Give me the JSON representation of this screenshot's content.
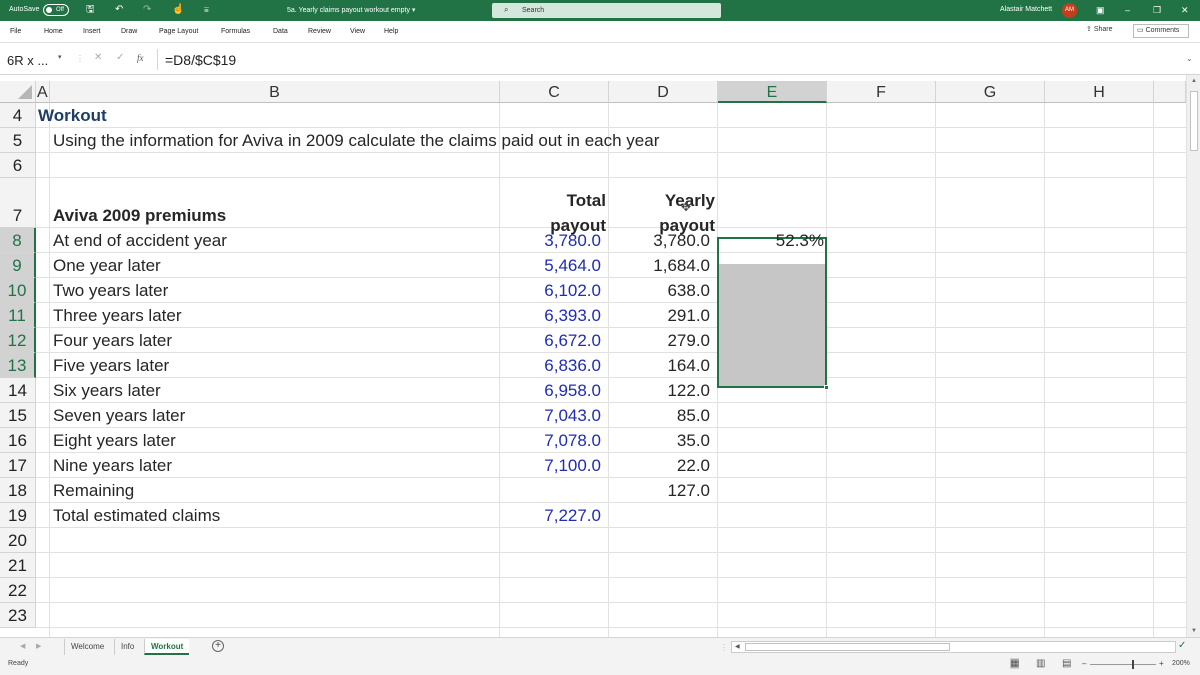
{
  "titlebar": {
    "autosave_label": "AutoSave",
    "autosave_state": "Off",
    "doc_title": "5a. Yearly claims payout workout empty",
    "doc_title_arrow": "▾",
    "search_placeholder": "Search",
    "user_name": "Alastair Matchett",
    "user_initials": "AM",
    "bg_color": "#217346"
  },
  "ribbon": {
    "tabs": [
      "File",
      "Home",
      "Insert",
      "Draw",
      "Page Layout",
      "Formulas",
      "Data",
      "Review",
      "View",
      "Help"
    ],
    "share_label": "Share",
    "comments_label": "Comments"
  },
  "formula_bar": {
    "name_box": "6R x ...",
    "fx": "fx",
    "formula": "=D8/$C$19"
  },
  "columns": {
    "A": "A",
    "B": "B",
    "C": "C",
    "D": "D",
    "E": "E",
    "F": "F",
    "G": "G",
    "H": "H"
  },
  "rows": [
    "4",
    "5",
    "6",
    "7",
    "8",
    "9",
    "10",
    "11",
    "12",
    "13",
    "14",
    "15",
    "16",
    "17",
    "18",
    "19",
    "20",
    "21",
    "22",
    "23"
  ],
  "sheet": {
    "title": "Workout",
    "instruction": "Using the information for Aviva in 2009 calculate the claims paid out in each year",
    "header_total_1": "Total",
    "header_total_2": "payout",
    "header_yearly_1": "Yearly",
    "header_yearly_2": "payout",
    "table_label": "Aviva 2009 premiums",
    "data_rows": [
      {
        "label": "At end of accident year",
        "total": "3,780.0",
        "yearly": "3,780.0",
        "pct": "52.3%"
      },
      {
        "label": "One year later",
        "total": "5,464.0",
        "yearly": "1,684.0",
        "pct": ""
      },
      {
        "label": "Two years later",
        "total": "6,102.0",
        "yearly": "638.0",
        "pct": ""
      },
      {
        "label": "Three years later",
        "total": "6,393.0",
        "yearly": "291.0",
        "pct": ""
      },
      {
        "label": "Four years later",
        "total": "6,672.0",
        "yearly": "279.0",
        "pct": ""
      },
      {
        "label": "Five years later",
        "total": "6,836.0",
        "yearly": "164.0",
        "pct": ""
      },
      {
        "label": "Six years later",
        "total": "6,958.0",
        "yearly": "122.0",
        "pct": ""
      },
      {
        "label": "Seven years later",
        "total": "7,043.0",
        "yearly": "85.0",
        "pct": ""
      },
      {
        "label": "Eight years later",
        "total": "7,078.0",
        "yearly": "35.0",
        "pct": ""
      },
      {
        "label": "Nine years later",
        "total": "7,100.0",
        "yearly": "22.0",
        "pct": ""
      },
      {
        "label": "Remaining",
        "total": "",
        "yearly": "127.0",
        "pct": ""
      },
      {
        "label": "Total estimated claims",
        "total": "7,227.0",
        "yearly": "",
        "pct": ""
      }
    ],
    "input_color": "#1f2cb4",
    "title_color": "#1f3d66"
  },
  "sheet_tabs": [
    "Welcome",
    "Info",
    "Workout"
  ],
  "active_sheet": "Workout",
  "status": {
    "ready": "Ready",
    "zoom": "200%"
  }
}
